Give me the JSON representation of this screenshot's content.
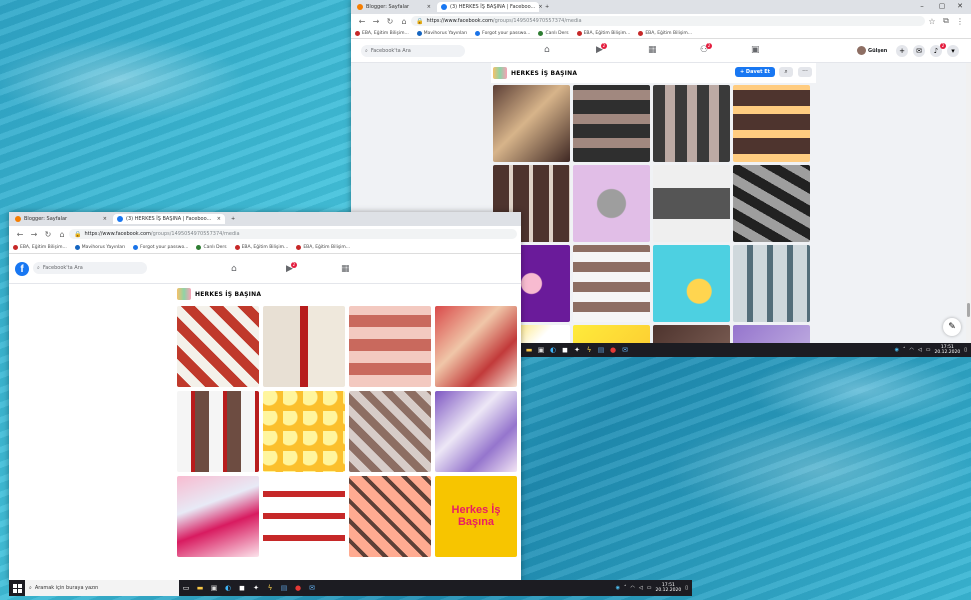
{
  "colors": {
    "fb_blue": "#1877f2",
    "notif_red": "#e41e3f",
    "taskbar": "#1c1c22"
  },
  "front_window": {
    "tabs": [
      {
        "label": "Blogger: Sayfalar",
        "favicon_color": "#f57d00"
      },
      {
        "label": "(3) HERKES İŞ BAŞINA | Faceboo...",
        "favicon_color": "#1877f2"
      }
    ],
    "new_tab": "+",
    "url": {
      "host": "https://www.facebook.com",
      "path": "/groups/1495054970557374/media"
    },
    "bookmarks": [
      {
        "label": "EBA, Eğitim Bilişim...",
        "color": "#c62828"
      },
      {
        "label": "Mavihorus Yayınları",
        "color": "#1565c0"
      },
      {
        "label": "Forgot your passwo...",
        "color": "#1a73e8"
      },
      {
        "label": "Canlı Ders",
        "color": "#2e7d32"
      },
      {
        "label": "EBA, Eğitim Bilişim...",
        "color": "#c62828"
      },
      {
        "label": "EBA, Eğitim Bilişim...",
        "color": "#c62828"
      }
    ],
    "search_placeholder": "Facebook'ta Ara",
    "group_name": "HERKES İŞ BAŞINA",
    "last_tile_text": "Herkes İş Başına"
  },
  "back_window": {
    "tabs": [
      {
        "label": "Blogger: Sayfalar",
        "favicon_color": "#f57d00"
      },
      {
        "label": "(3) HERKES İŞ BAŞINA | Faceboo...",
        "favicon_color": "#1877f2"
      }
    ],
    "new_tab": "+",
    "url": {
      "host": "https://www.facebook.com",
      "path": "/groups/1495054970557374/media"
    },
    "bookmarks": [
      {
        "label": "EBA, Eğitim Bilişim...",
        "color": "#c62828"
      },
      {
        "label": "Mavihorus Yayınları",
        "color": "#1565c0"
      },
      {
        "label": "Forgot your passwo...",
        "color": "#1a73e8"
      },
      {
        "label": "Canlı Ders",
        "color": "#2e7d32"
      },
      {
        "label": "EBA, Eğitim Bilişim...",
        "color": "#c62828"
      },
      {
        "label": "EBA, Eğitim Bilişim...",
        "color": "#c62828"
      }
    ],
    "search_placeholder": "Facebook'ta Ara",
    "profile_name": "Gülşen",
    "group_name": "HERKES İŞ BAŞINA",
    "invite_label": "+ Davet Et",
    "notif_counts": [
      "2",
      "2",
      "2"
    ]
  },
  "taskbar": {
    "search_placeholder": "Aramak için buraya yazın",
    "time": "17:51",
    "date": "20.12.2020"
  }
}
